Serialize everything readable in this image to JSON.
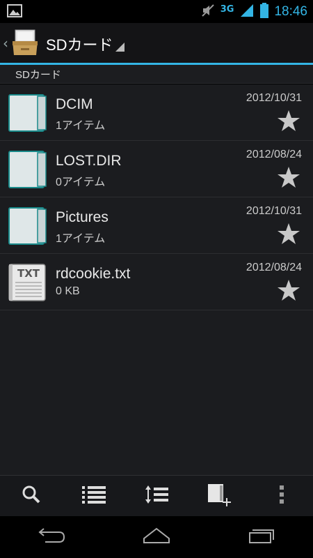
{
  "status_bar": {
    "network": "3G",
    "time": "18:46"
  },
  "action_bar": {
    "title": "SDカード"
  },
  "breadcrumb": {
    "path": "SDカード"
  },
  "files": [
    {
      "name": "DCIM",
      "meta": "1アイテム",
      "date": "2012/10/31",
      "type": "folder"
    },
    {
      "name": "LOST.DIR",
      "meta": "0アイテム",
      "date": "2012/08/24",
      "type": "folder"
    },
    {
      "name": "Pictures",
      "meta": "1アイテム",
      "date": "2012/10/31",
      "type": "folder"
    },
    {
      "name": "rdcookie.txt",
      "meta": "0 KB",
      "date": "2012/08/24",
      "type": "txt"
    }
  ],
  "icons": {
    "txt_label": "TXT"
  },
  "colors": {
    "accent": "#33b5e5",
    "background": "#1b1c1f"
  }
}
